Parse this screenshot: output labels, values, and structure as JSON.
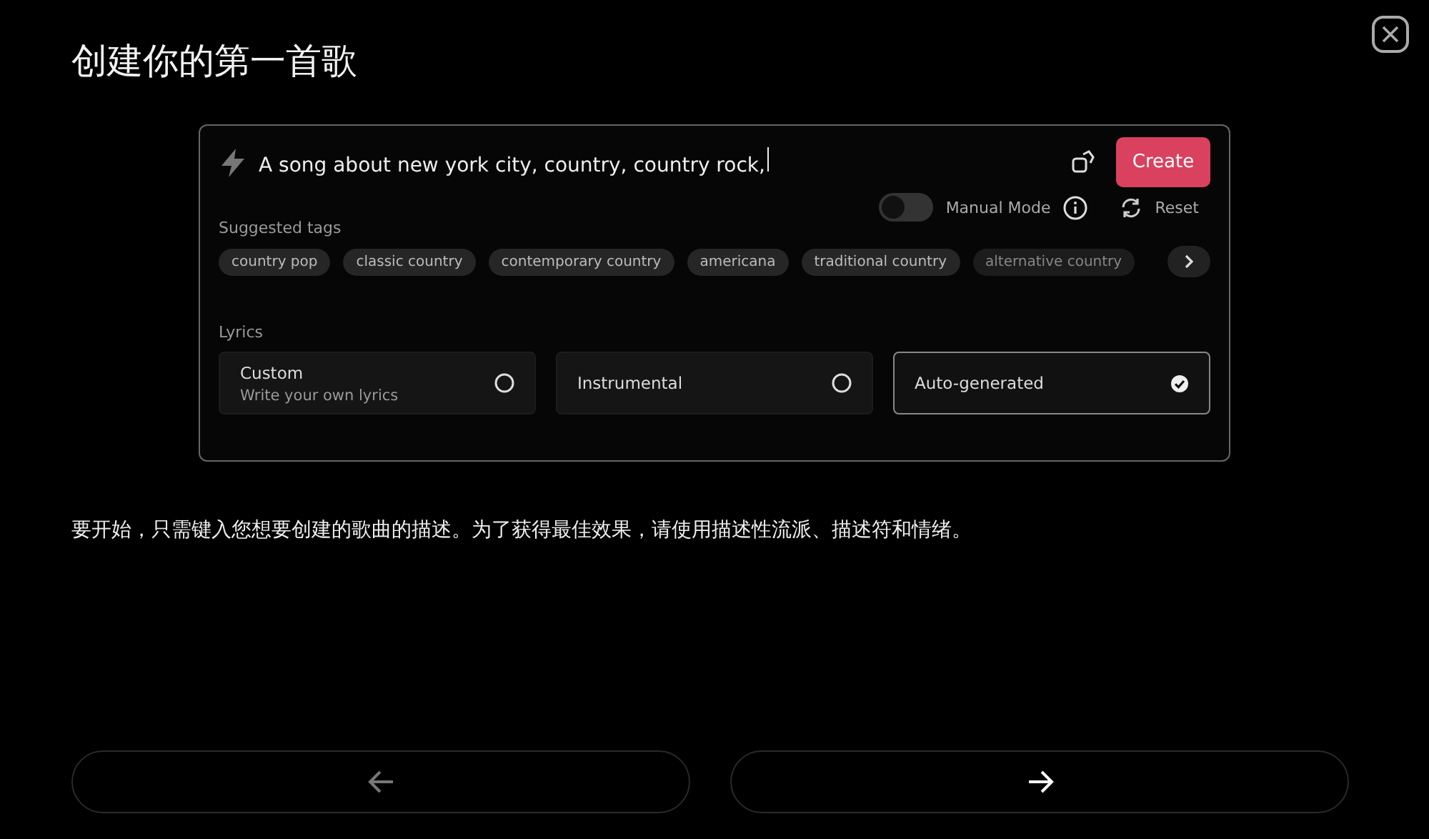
{
  "title": "创建你的第一首歌",
  "prompt": {
    "value": "A song about new york city, country, country rock,",
    "create_label": "Create"
  },
  "manual_mode": {
    "label": "Manual Mode",
    "on": false
  },
  "reset_label": "Reset",
  "suggested_tags": {
    "label": "Suggested tags",
    "items": [
      "country pop",
      "classic country",
      "contemporary country",
      "americana",
      "traditional country",
      "alternative country"
    ]
  },
  "lyrics": {
    "label": "Lyrics",
    "options": [
      {
        "title": "Custom",
        "subtitle": "Write your own lyrics",
        "selected": false
      },
      {
        "title": "Instrumental",
        "selected": false
      },
      {
        "title": "Auto-generated",
        "selected": true
      }
    ]
  },
  "description": "要开始，只需键入您想要创建的歌曲的描述。为了获得最佳效果，请使用描述性流派、描述符和情绪。",
  "nav": {
    "back": {
      "disabled": true
    },
    "next": {
      "disabled": false
    }
  }
}
